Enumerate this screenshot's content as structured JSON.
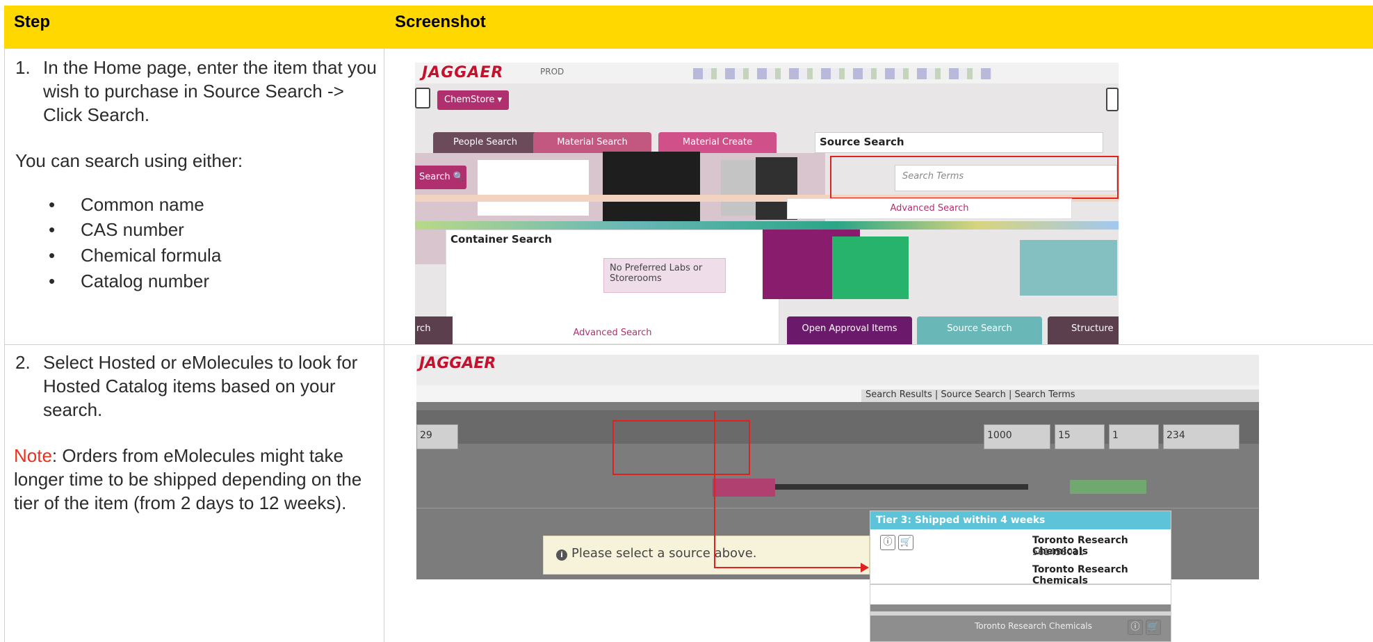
{
  "header": {
    "step": "Step",
    "screenshot": "Screenshot"
  },
  "steps": [
    {
      "num": "1.",
      "text": "In the Home page, enter the item that you wish to purchase in Source Search -> Click Search.",
      "sub": "You can search using either:",
      "bullets": [
        "Common name",
        "CAS number",
        "Chemical formula",
        "Catalog number"
      ]
    },
    {
      "num": "2.",
      "text": "Select Hosted or eMolecules to look for Hosted Catalog items based on your search.",
      "note_label": "Note",
      "note_text": ": Orders from eMolecules might take longer time to be shipped depending on the tier of the item (from 2 days to 12 weeks)."
    }
  ],
  "shot1": {
    "logo": "JAGGAER",
    "env": "PROD",
    "store_button": "ChemStore",
    "tabs": [
      "People Search",
      "Material Search",
      "Material Create"
    ],
    "source_search_title": "Source Search",
    "search_button": "Search",
    "search_placeholder": "Search Terms",
    "advanced_search": "Advanced Search",
    "container_title": "Container Search",
    "no_pref": "No Preferred Labs or Storerooms",
    "container_advanced": "Advanced Search",
    "bottom_tabs": [
      "rch",
      "Open Approval Items",
      "Source Search",
      "Structure Sea"
    ],
    "colors": {
      "brand": "#b0306f",
      "tab_dark": "#6b4a5a",
      "tab_pink": "#c2587f",
      "tab_magenta": "#d0508a",
      "teal": "#6ab7b8",
      "highlight": "#e0211e"
    }
  },
  "shot2": {
    "logo": "JAGGAER",
    "breadcrumb": "Search Results | Source Search | Search Terms",
    "filters": [
      "29",
      "1000",
      "15",
      "1",
      "234"
    ],
    "alert": "Please select a source above."
  },
  "tier_popup": {
    "title": "Tier 3: Shipped within 4 weeks",
    "row1_name": "Toronto Research Chemicals",
    "row1_num": "561458011",
    "row2_name": "Toronto Research Chemicals",
    "row3_name": "Toronto Research Chemicals"
  }
}
